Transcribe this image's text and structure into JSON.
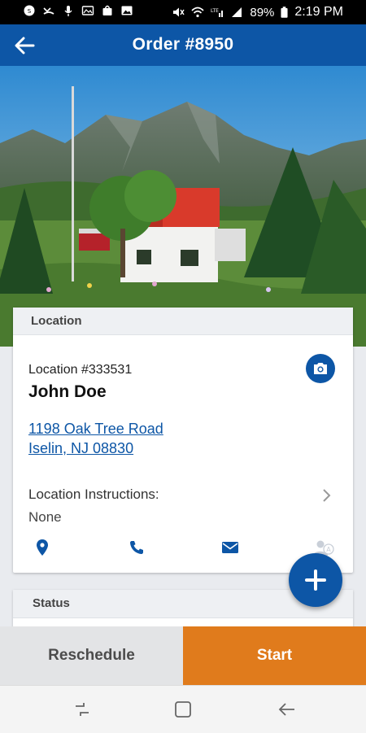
{
  "status_bar": {
    "battery": "89%",
    "time": "2:19 PM",
    "icons_left": [
      "sync-icon",
      "missed-call-icon",
      "mic-icon",
      "gallery-icon",
      "bag-icon",
      "image-icon"
    ],
    "icons_right": [
      "mute-icon",
      "wifi-icon",
      "lte-signal-icon",
      "signal-icon",
      "battery-icon"
    ]
  },
  "app_bar": {
    "title": "Order #8950"
  },
  "location_card": {
    "header": "Location",
    "location_number": "Location #333531",
    "customer_name": "John Doe",
    "address_line1": "1198 Oak Tree Road",
    "address_line2": "Iselin, NJ 08830",
    "instructions_label": "Location Instructions:",
    "instructions_value": "None",
    "actions": [
      "map-pin-icon",
      "phone-icon",
      "email-icon",
      "contacts-icon"
    ]
  },
  "status_card": {
    "header": "Status"
  },
  "buttons": {
    "reschedule": "Reschedule",
    "start": "Start"
  },
  "colors": {
    "primary": "#0d56a6",
    "accent": "#e07b1c"
  }
}
